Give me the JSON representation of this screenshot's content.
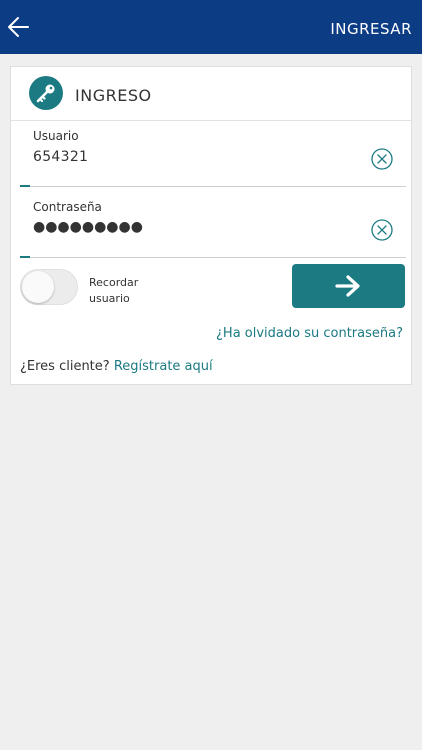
{
  "topbar": {
    "back_icon": "arrow-left-icon",
    "title": "INGRESAR",
    "bg_color": "#0c3c84"
  },
  "card": {
    "icon": "key-icon",
    "title": "INGRESO",
    "accent_color": "#1b7a82"
  },
  "fields": {
    "user": {
      "label": "Usuario",
      "value": "654321",
      "clear_icon": "clear-circle-icon"
    },
    "password": {
      "label": "Contraseña",
      "value": "●●●●●●●●●",
      "clear_icon": "clear-circle-icon"
    }
  },
  "remember": {
    "label_line1": "Recordar",
    "label_line2": "usuario",
    "enabled": false
  },
  "submit": {
    "icon": "arrow-right-icon"
  },
  "links": {
    "forgot": "¿Ha olvidado su contraseña?",
    "signup_prompt": "¿Eres cliente?",
    "signup": "Regístrate aquí"
  }
}
